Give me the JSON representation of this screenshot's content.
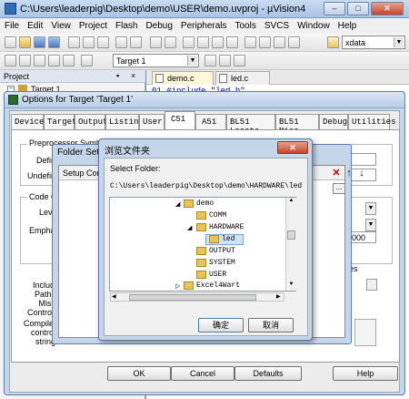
{
  "window": {
    "title": "C:\\Users\\leaderpig\\Desktop\\demo\\USER\\demo.uvproj - µVision4"
  },
  "menu": [
    "File",
    "Edit",
    "View",
    "Project",
    "Flash",
    "Debug",
    "Peripherals",
    "Tools",
    "SVCS",
    "Window",
    "Help"
  ],
  "toolbar": {
    "search_value": "xdata",
    "target_value": "Target 1"
  },
  "project_panel": {
    "title": "Project",
    "tree_item": "Target 1"
  },
  "editor": {
    "tabs": [
      "demo.c",
      "led.c"
    ],
    "code_line": "01  #include \"led.h\""
  },
  "options_dialog": {
    "title": "Options for Target 'Target 1'",
    "tabs": [
      "Device",
      "Target",
      "Output",
      "Listing",
      "User",
      "C51",
      "A51",
      "BL51 Locate",
      "BL51 Misc",
      "Debug",
      "Utilities"
    ],
    "active_tab": "C51",
    "labels": {
      "preprocessor": "Preprocessor Symbols",
      "define": "Define:",
      "undefine": "Undefine:",
      "code_opt": "Code Opti",
      "level": "Level:",
      "emphasis": "Emphasis:",
      "include_paths": "Include\nPaths",
      "misc_controls": "Misc\nControls",
      "compiler_control": "Compiler\ncontrol\nstring"
    },
    "right_value": "000",
    "right_label": "es",
    "buttons": {
      "ok": "OK",
      "cancel": "Cancel",
      "defaults": "Defaults",
      "help": "Help"
    }
  },
  "folder_setup": {
    "title": "Folder Setu",
    "header": "Setup Comp"
  },
  "browse_dialog": {
    "title": "浏览文件夹",
    "select_label": "Select Folder:",
    "path": "C:\\Users\\leaderpig\\Desktop\\demo\\HARDWARE\\led",
    "tree": [
      {
        "label": "demo",
        "level": 0
      },
      {
        "label": "COMM",
        "level": 1
      },
      {
        "label": "HARDWARE",
        "level": 1
      },
      {
        "label": "led",
        "level": 2,
        "selected": true
      },
      {
        "label": "OUTPUT",
        "level": 1
      },
      {
        "label": "SYSTEM",
        "level": 1
      },
      {
        "label": "USER",
        "level": 1
      },
      {
        "label": "Excel4Wart",
        "level": 0
      }
    ],
    "ok_label": "确定",
    "cancel_label": "取消"
  }
}
